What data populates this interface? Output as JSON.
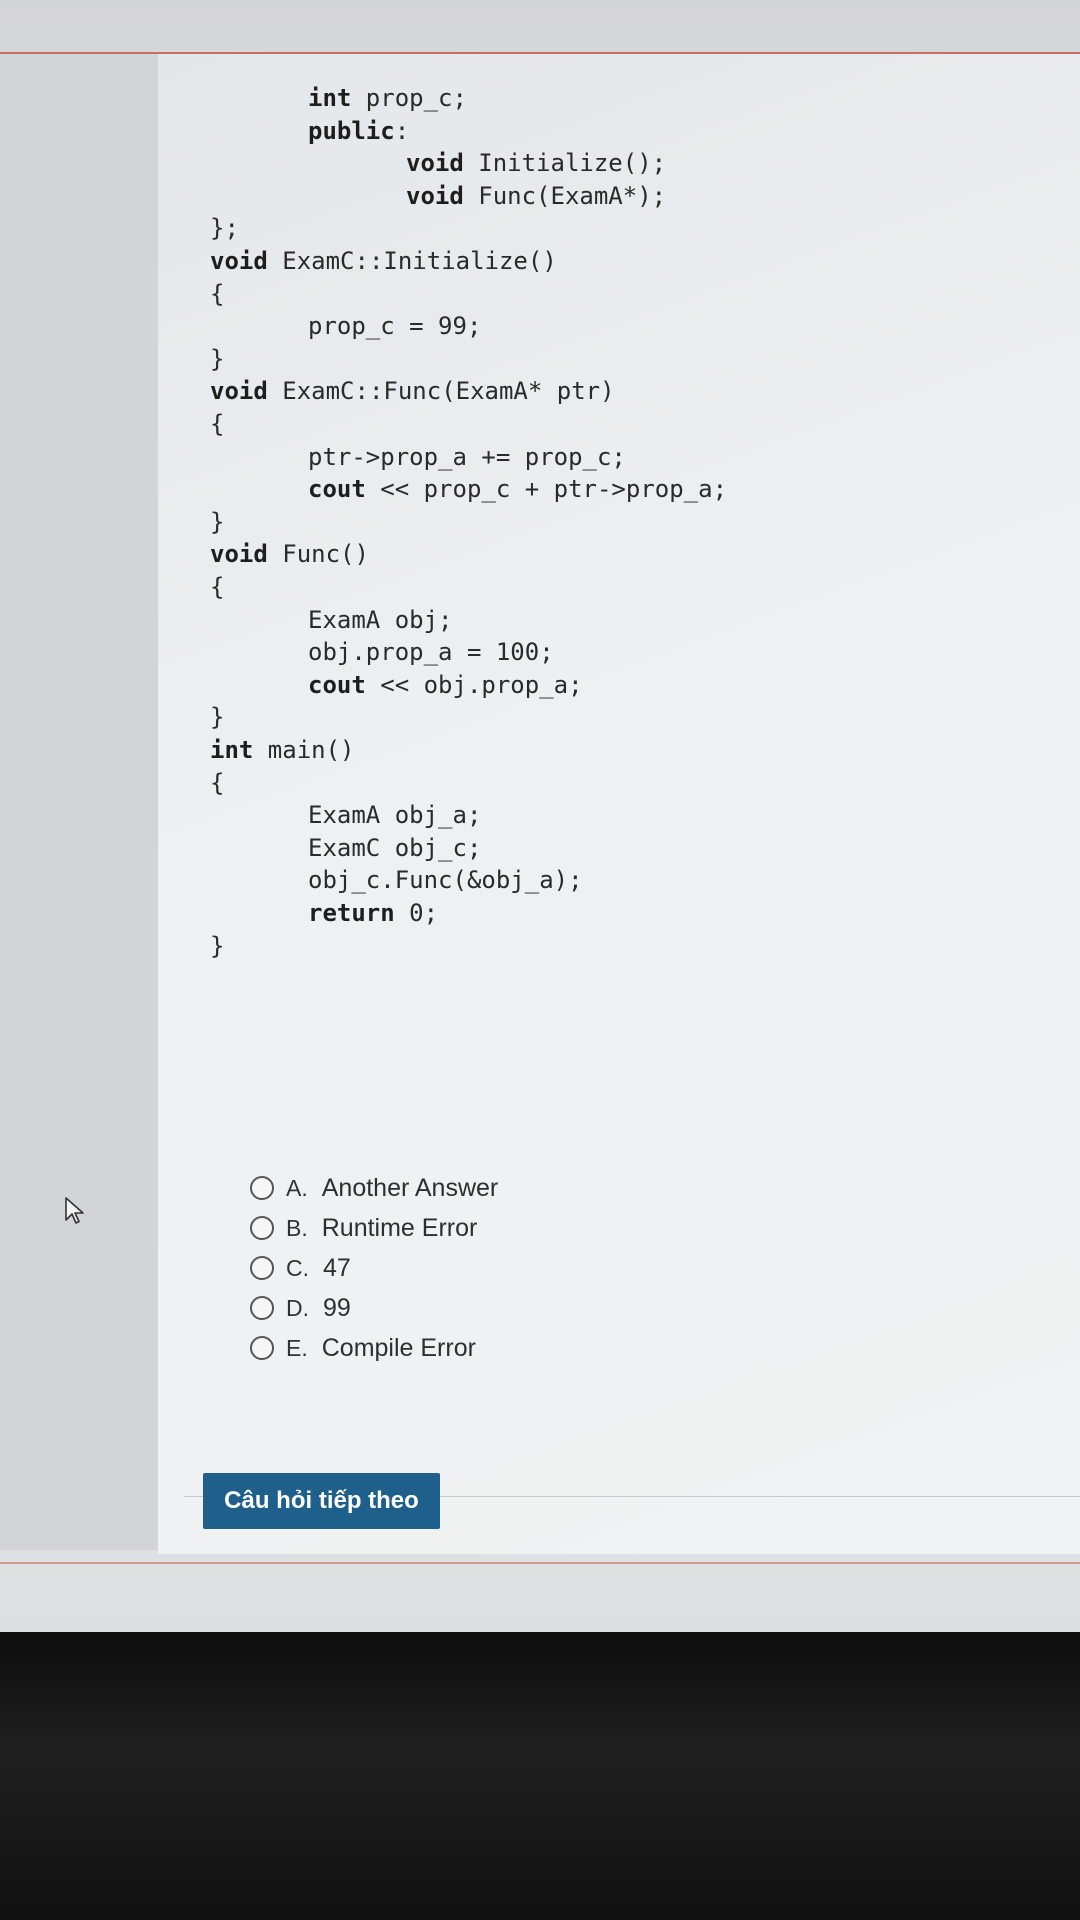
{
  "code": {
    "lines": [
      {
        "indent": 1,
        "parts": [
          {
            "t": "int",
            "kw": true
          },
          {
            "t": " prop_c;",
            "kw": false
          }
        ]
      },
      {
        "indent": 1,
        "parts": [
          {
            "t": "public",
            "kw": true
          },
          {
            "t": ":",
            "kw": false
          }
        ]
      },
      {
        "indent": 2,
        "parts": [
          {
            "t": "void",
            "kw": true
          },
          {
            "t": " Initialize();",
            "kw": false
          }
        ]
      },
      {
        "indent": 2,
        "parts": [
          {
            "t": "void",
            "kw": true
          },
          {
            "t": " Func(ExamA*);",
            "kw": false
          }
        ]
      },
      {
        "indent": 0,
        "parts": [
          {
            "t": "};",
            "kw": false
          }
        ]
      },
      {
        "indent": 0,
        "parts": [
          {
            "t": "void",
            "kw": true
          },
          {
            "t": " ExamC::Initialize()",
            "kw": false
          }
        ]
      },
      {
        "indent": 0,
        "parts": [
          {
            "t": "{",
            "kw": false
          }
        ]
      },
      {
        "indent": 1,
        "parts": [
          {
            "t": "prop_c = 99;",
            "kw": false
          }
        ]
      },
      {
        "indent": 0,
        "parts": [
          {
            "t": "}",
            "kw": false
          }
        ]
      },
      {
        "indent": 0,
        "parts": [
          {
            "t": "void",
            "kw": true
          },
          {
            "t": " ExamC::Func(ExamA* ptr)",
            "kw": false
          }
        ]
      },
      {
        "indent": 0,
        "parts": [
          {
            "t": "{",
            "kw": false
          }
        ]
      },
      {
        "indent": 1,
        "parts": [
          {
            "t": "ptr->prop_a += prop_c;",
            "kw": false
          }
        ]
      },
      {
        "indent": 1,
        "parts": [
          {
            "t": "cout",
            "kw": true
          },
          {
            "t": " << prop_c + ptr->prop_a;",
            "kw": false
          }
        ]
      },
      {
        "indent": 0,
        "parts": [
          {
            "t": "}",
            "kw": false
          }
        ]
      },
      {
        "indent": 0,
        "parts": [
          {
            "t": "void",
            "kw": true
          },
          {
            "t": " Func()",
            "kw": false
          }
        ]
      },
      {
        "indent": 0,
        "parts": [
          {
            "t": "{",
            "kw": false
          }
        ]
      },
      {
        "indent": 1,
        "parts": [
          {
            "t": "ExamA obj;",
            "kw": false
          }
        ]
      },
      {
        "indent": 1,
        "parts": [
          {
            "t": "obj.prop_a = 100;",
            "kw": false
          }
        ]
      },
      {
        "indent": 1,
        "parts": [
          {
            "t": "cout",
            "kw": true
          },
          {
            "t": " << obj.prop_a;",
            "kw": false
          }
        ]
      },
      {
        "indent": 0,
        "parts": [
          {
            "t": "}",
            "kw": false
          }
        ]
      },
      {
        "indent": 0,
        "parts": [
          {
            "t": "int",
            "kw": true
          },
          {
            "t": " main()",
            "kw": false
          }
        ]
      },
      {
        "indent": 0,
        "parts": [
          {
            "t": "{",
            "kw": false
          }
        ]
      },
      {
        "indent": 1,
        "parts": [
          {
            "t": "ExamA obj_a;",
            "kw": false
          }
        ]
      },
      {
        "indent": 1,
        "parts": [
          {
            "t": "ExamC obj_c;",
            "kw": false
          }
        ]
      },
      {
        "indent": 1,
        "parts": [
          {
            "t": "obj_c.Func(&obj_a);",
            "kw": false
          }
        ]
      },
      {
        "indent": 1,
        "parts": [
          {
            "t": "return",
            "kw": true
          },
          {
            "t": " 0;",
            "kw": false
          }
        ]
      },
      {
        "indent": 0,
        "parts": [
          {
            "t": "}",
            "kw": false
          }
        ]
      }
    ]
  },
  "options": [
    {
      "letter": "A.",
      "text": "Another Answer"
    },
    {
      "letter": "B.",
      "text": "Runtime Error"
    },
    {
      "letter": "C.",
      "text": "47"
    },
    {
      "letter": "D.",
      "text": "99"
    },
    {
      "letter": "E.",
      "text": "Compile Error"
    }
  ],
  "next_button": {
    "label": "Câu hỏi tiếp theo"
  },
  "colors": {
    "button": "#1e5f8c",
    "accent_line": "#c24a3b"
  },
  "icons": {
    "cursor": "mouse-pointer-icon"
  }
}
